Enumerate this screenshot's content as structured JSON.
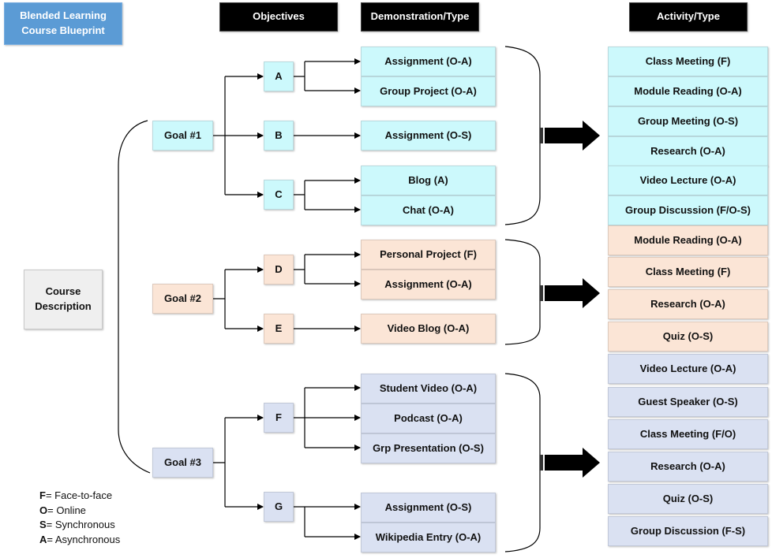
{
  "title": "Blended Learning Course Blueprint",
  "headers": {
    "objectives": "Objectives",
    "demonstration": "Demonstration/Type",
    "activity": "Activity/Type"
  },
  "course_description": "Course Description",
  "colors": {
    "goal1": "#ccf9fc",
    "goal2": "#fbe5d6",
    "goal3": "#dae1f2",
    "title": "#5b9bd5",
    "header": "#000000"
  },
  "goals": [
    {
      "label": "Goal #1",
      "objectives": [
        {
          "label": "A",
          "demonstrations": [
            "Assignment (O-A)",
            "Group Project (O-A)"
          ]
        },
        {
          "label": "B",
          "demonstrations": [
            "Assignment (O-S)"
          ]
        },
        {
          "label": "C",
          "demonstrations": [
            "Blog (A)",
            "Chat (O-A)"
          ]
        }
      ],
      "activities": [
        "Class Meeting (F)",
        "Module Reading (O-A)",
        "Group Meeting (O-S)",
        "Research (O-A)",
        "Video Lecture (O-A)",
        "Group Discussion (F/O-S)"
      ]
    },
    {
      "label": "Goal #2",
      "objectives": [
        {
          "label": "D",
          "demonstrations": [
            "Personal Project (F)",
            "Assignment (O-A)"
          ]
        },
        {
          "label": "E",
          "demonstrations": [
            "Video Blog (O-A)"
          ]
        }
      ],
      "activities": [
        "Module Reading (O-A)",
        "Class Meeting (F)",
        "Research (O-A)",
        "Quiz (O-S)"
      ]
    },
    {
      "label": "Goal #3",
      "objectives": [
        {
          "label": "F",
          "demonstrations": [
            "Student Video (O-A)",
            "Podcast (O-A)",
            "Grp Presentation (O-S)"
          ]
        },
        {
          "label": "G",
          "demonstrations": [
            "Assignment (O-S)",
            "Wikipedia Entry (O-A)"
          ]
        }
      ],
      "activities": [
        "Video Lecture (O-A)",
        "Guest Speaker (O-S)",
        "Class Meeting (F/O)",
        "Research (O-A)",
        "Quiz (O-S)",
        "Group Discussion (F-S)"
      ]
    }
  ],
  "legend": [
    {
      "key": "F",
      "text": "= Face-to-face"
    },
    {
      "key": "O",
      "text": "= Online"
    },
    {
      "key": "S",
      "text": "= Synchronous"
    },
    {
      "key": "A",
      "text": "= Asynchronous"
    }
  ]
}
